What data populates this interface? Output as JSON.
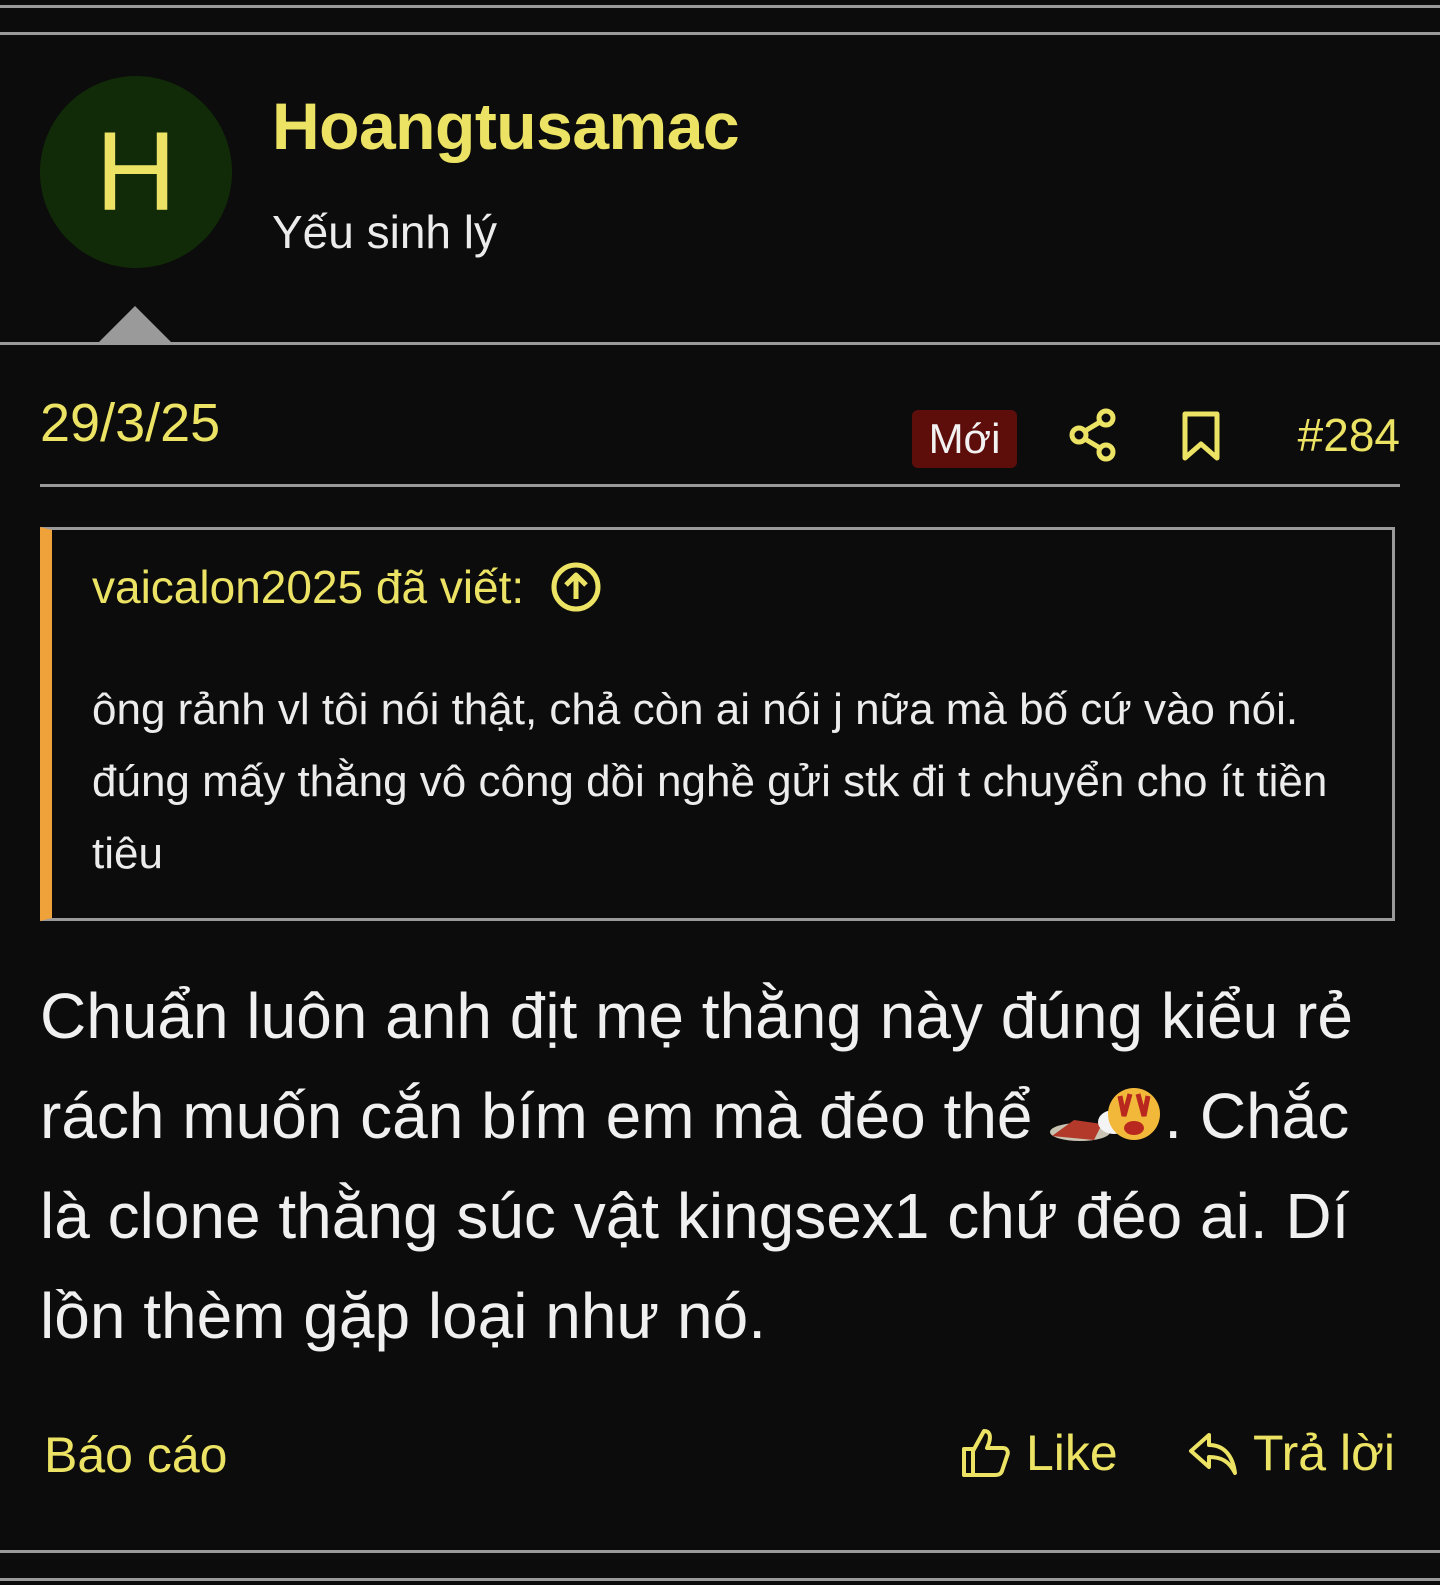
{
  "author": {
    "avatar_letter": "H",
    "name": "Hoangtusamac",
    "title": "Yếu sinh lý",
    "avatar_color": "#112b09"
  },
  "post": {
    "date": "29/3/25",
    "badge": "Mới",
    "number": "#284",
    "body_part1": "Chuẩn luôn anh địt mẹ thằng này đúng kiểu rẻ rách muốn cắn bím em mà đéo thể ",
    "body_part2": ". Chắc là clone thằng súc vật kingsex1 chứ đéo ai. Dí lồn thèm gặp loại như nó.",
    "icons": {
      "share": "share-icon",
      "bookmark": "bookmark-icon",
      "smiley": "smiley-icon"
    }
  },
  "quote": {
    "author": "vaicalon2025 đã viết:",
    "text": "ông rảnh vl tôi nói thật, chả còn ai nói j nữa mà bố cứ vào nói. đúng mấy thằng vô công dồi nghề gửi stk đi t chuyển cho ít tiền tiêu",
    "icon": "arrow-up-circle-icon"
  },
  "actions": {
    "report": "Báo cáo",
    "like": "Like",
    "reply": "Trả lời"
  },
  "colors": {
    "accent": "#ece364",
    "quote_bar": "#f0a23a",
    "badge_bg": "#5e0e0a",
    "background": "#0c0c0c",
    "rule": "#9a9a9a"
  }
}
